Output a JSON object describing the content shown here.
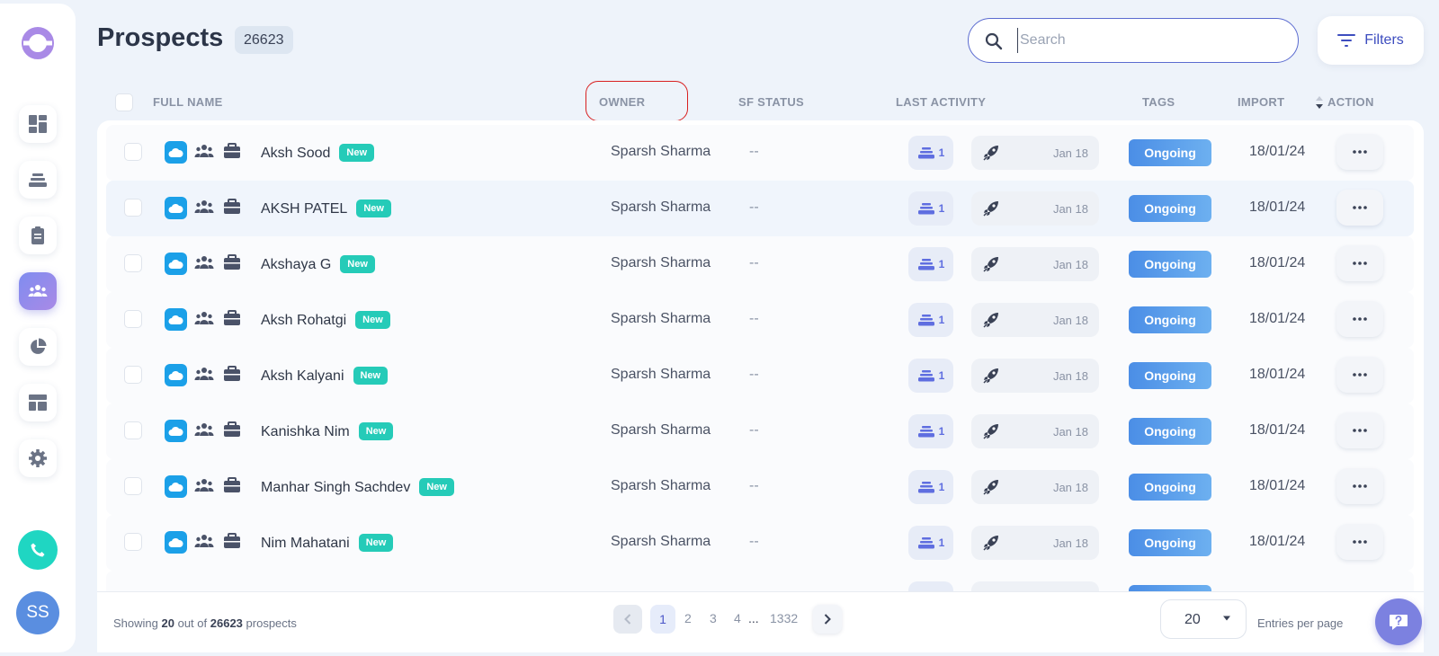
{
  "sidebar": {
    "avatar_initials": "SS",
    "items": [
      "dashboard",
      "sequences",
      "tasks",
      "prospects",
      "reports",
      "templates",
      "settings"
    ],
    "active": "prospects"
  },
  "header": {
    "title": "Prospects",
    "count": "26623",
    "search_placeholder": "Search",
    "filters_label": "Filters"
  },
  "table": {
    "columns": {
      "full_name": "FULL NAME",
      "owner": "OWNER",
      "sf_status": "SF STATUS",
      "last_activity": "LAST ACTIVITY",
      "tags": "TAGS",
      "import": "IMPORT",
      "action": "ACTION"
    },
    "rows": [
      {
        "name": "Aksh Sood",
        "badge": "New",
        "owner": "Sparsh Sharma",
        "sf_status": "--",
        "sequences": "1",
        "activity_date": "Jan 18",
        "tag": "Ongoing",
        "import": "18/01/24"
      },
      {
        "name": "AKSH PATEL",
        "badge": "New",
        "owner": "Sparsh Sharma",
        "sf_status": "--",
        "sequences": "1",
        "activity_date": "Jan 18",
        "tag": "Ongoing",
        "import": "18/01/24"
      },
      {
        "name": "Akshaya G",
        "badge": "New",
        "owner": "Sparsh Sharma",
        "sf_status": "--",
        "sequences": "1",
        "activity_date": "Jan 18",
        "tag": "Ongoing",
        "import": "18/01/24"
      },
      {
        "name": "Aksh Rohatgi",
        "badge": "New",
        "owner": "Sparsh Sharma",
        "sf_status": "--",
        "sequences": "1",
        "activity_date": "Jan 18",
        "tag": "Ongoing",
        "import": "18/01/24"
      },
      {
        "name": "Aksh Kalyani",
        "badge": "New",
        "owner": "Sparsh Sharma",
        "sf_status": "--",
        "sequences": "1",
        "activity_date": "Jan 18",
        "tag": "Ongoing",
        "import": "18/01/24"
      },
      {
        "name": "Kanishka Nim",
        "badge": "New",
        "owner": "Sparsh Sharma",
        "sf_status": "--",
        "sequences": "1",
        "activity_date": "Jan 18",
        "tag": "Ongoing",
        "import": "18/01/24"
      },
      {
        "name": "Manhar Singh Sachdev",
        "badge": "New",
        "owner": "Sparsh Sharma",
        "sf_status": "--",
        "sequences": "1",
        "activity_date": "Jan 18",
        "tag": "Ongoing",
        "import": "18/01/24"
      },
      {
        "name": "Nim Mahatani",
        "badge": "New",
        "owner": "Sparsh Sharma",
        "sf_status": "--",
        "sequences": "1",
        "activity_date": "Jan 18",
        "tag": "Ongoing",
        "import": "18/01/24"
      }
    ]
  },
  "footer": {
    "showing_prefix": "Showing",
    "shown": "20",
    "out_of": "out of",
    "total": "26623",
    "suffix": "prospects",
    "pages": [
      "1",
      "2",
      "3",
      "4"
    ],
    "ellipsis": "...",
    "last_page": "1332",
    "per_page": "20",
    "entries_label": "Entries per page"
  },
  "colors": {
    "accent": "#5b6bd0",
    "new_badge": "#25cbb8",
    "tag_ongoing": "#4b8ee6",
    "highlight_ring": "#d82020"
  }
}
